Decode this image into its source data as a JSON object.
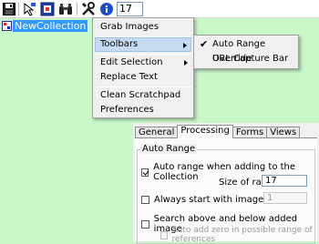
{
  "toolbar": {
    "buttons": [
      {
        "name": "save",
        "icon": "floppy-disk-icon"
      },
      {
        "name": "pick",
        "icon": "grab-tool-icon"
      },
      {
        "name": "capture",
        "icon": "capture-icon"
      },
      {
        "name": "find",
        "icon": "binoculars-icon"
      },
      {
        "name": "tools",
        "icon": "tools-icon"
      },
      {
        "name": "info",
        "icon": "info-icon"
      }
    ],
    "zoom_value": "17"
  },
  "tree": {
    "node_label": "NewCollection"
  },
  "context_menu": {
    "items": [
      {
        "label": "Grab Images"
      },
      {
        "label": "Toolbars"
      },
      {
        "label": "Edit Selection"
      },
      {
        "label": "Replace Text"
      },
      {
        "label": "Clean Scratchpad"
      },
      {
        "label": "Preferences"
      }
    ]
  },
  "submenu": {
    "items": [
      {
        "label": "Auto Range Override",
        "checked": true
      },
      {
        "label": "URL Capture Bar",
        "checked": false
      }
    ]
  },
  "settings": {
    "tabs": [
      "General",
      "Processing",
      "Forms",
      "Views"
    ],
    "active_tab": "Processing",
    "group_title": "Auto Range",
    "auto_range_label": "Auto range when adding to the Collection",
    "size_of_range_label": "Size of range",
    "size_of_range_value": "17",
    "always_start_label": "Always start with image number:",
    "start_number_value": "1",
    "search_label": "Search above and below added image",
    "auto_add_zero_label": "Auto add zero in possible range of references"
  },
  "colors": {
    "background": "#c8f7c8",
    "selection": "#3399ff",
    "menu_highlight": "#c6dbf2"
  }
}
